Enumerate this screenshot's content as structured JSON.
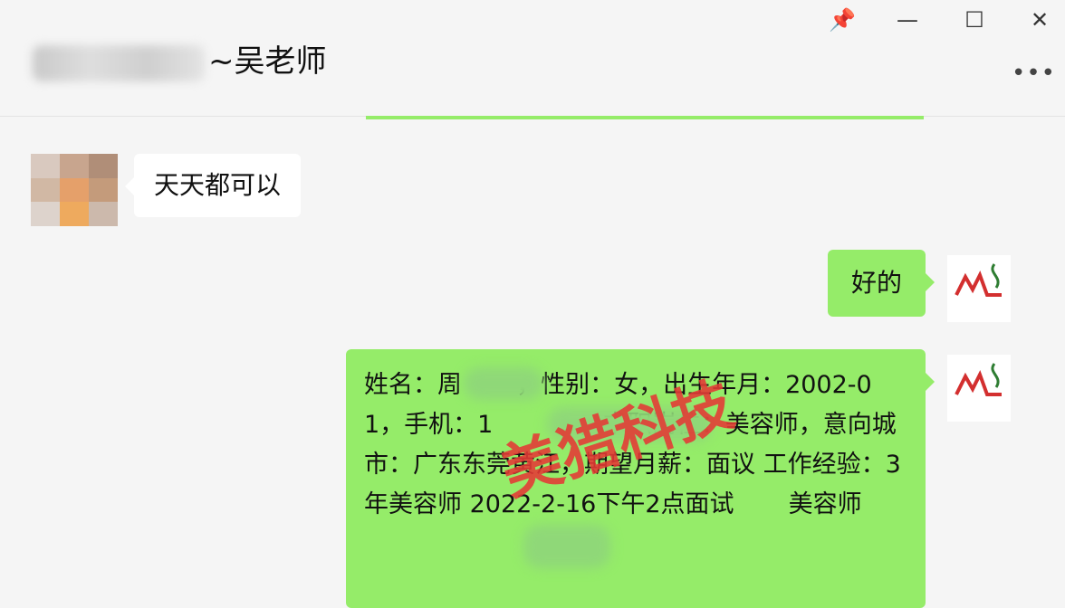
{
  "window": {
    "title_suffix": "~吴老师",
    "controls": {
      "pin": "📌",
      "minimize": "—",
      "maximize": "☐",
      "close": "✕"
    },
    "more": "•••"
  },
  "messages": {
    "left_1": "天天都可以",
    "right_1": "好的",
    "right_2": "姓名：周       ，性别：女，出生年月：2002-01，手机：1           ，求职岗位：美容师，意向城市：广东东莞黄江，期望月薪：面议 工作经验：3年美容师 2022-2-16下午2点面试       美容师"
  },
  "watermark": "美猎科技",
  "colors": {
    "bubble_green": "#95ec69",
    "watermark_red": "#e53935"
  }
}
